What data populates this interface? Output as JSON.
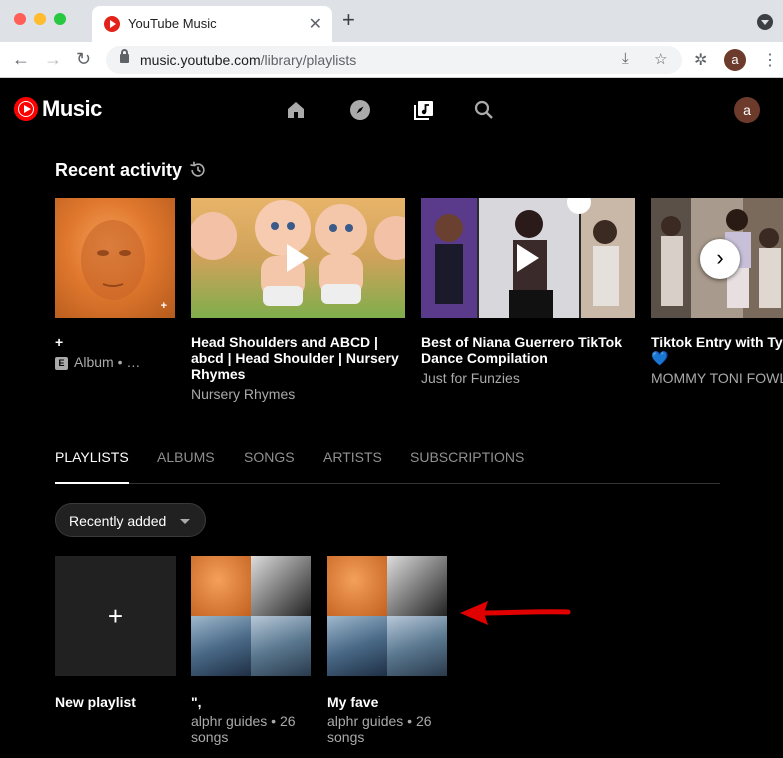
{
  "browser": {
    "tab_title": "YouTube Music",
    "url_host": "music.youtube.com",
    "url_path": "/library/playlists",
    "profile_initial": "a",
    "traffic_lights": [
      "#ff5f57",
      "#febc2e",
      "#28c840"
    ]
  },
  "app": {
    "logo_text": "Music",
    "nav_icons": [
      "home-icon",
      "explore-icon",
      "library-icon",
      "search-icon"
    ],
    "avatar_initial": "a",
    "accent": "#ff0000"
  },
  "recent": {
    "title": "Recent activity",
    "items": [
      {
        "title": "+",
        "subtitle": "Album • …",
        "explicit_badge": "E"
      },
      {
        "title": "Head Shoulders and ABCD | abcd | Head Shoulder | Nursery Rhymes",
        "subtitle": "Nursery Rhymes"
      },
      {
        "title": "Best of Niana Guerrero TikTok Dance Compilation",
        "subtitle": "Just for Funzies"
      },
      {
        "title": "Tiktok Entry with Tyr",
        "title_extra": "💙",
        "subtitle": "MOMMY TONI FOWL"
      }
    ]
  },
  "library_tabs": [
    {
      "label": "PLAYLISTS",
      "active": true
    },
    {
      "label": "ALBUMS",
      "active": false
    },
    {
      "label": "SONGS",
      "active": false
    },
    {
      "label": "ARTISTS",
      "active": false
    },
    {
      "label": "SUBSCRIPTIONS",
      "active": false
    }
  ],
  "sort": {
    "label": "Recently added"
  },
  "playlists": [
    {
      "title": "New playlist",
      "subtitle": ""
    },
    {
      "title": "\",",
      "subtitle": "alphr guides • 26 songs"
    },
    {
      "title": "My fave",
      "subtitle": "alphr guides • 26 songs"
    }
  ]
}
